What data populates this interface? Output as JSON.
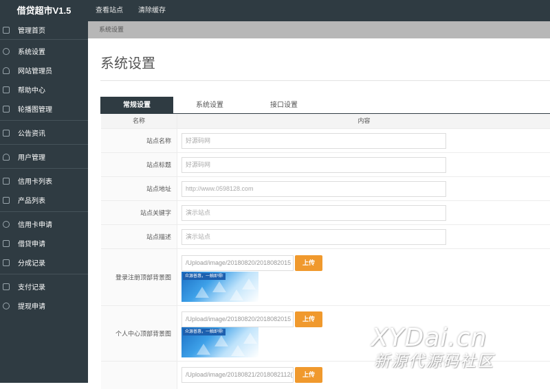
{
  "app": {
    "title": "借贷超市V1.5"
  },
  "topnav": [
    "查看站点",
    "清除缓存"
  ],
  "sidebar": {
    "items": [
      {
        "label": "管理首页",
        "icon": "home-icon"
      },
      {
        "label": "系统设置",
        "icon": "gear-icon"
      },
      {
        "label": "网站管理员",
        "icon": "user-icon"
      },
      {
        "label": "帮助中心",
        "icon": "help-icon"
      },
      {
        "label": "轮播图管理",
        "icon": "image-icon"
      },
      {
        "label": "公告资讯",
        "icon": "news-icon"
      },
      {
        "label": "用户管理",
        "icon": "users-icon"
      },
      {
        "label": "信用卡列表",
        "icon": "grid-icon"
      },
      {
        "label": "产品列表",
        "icon": "square-icon"
      },
      {
        "label": "信用卡申请",
        "icon": "link-icon"
      },
      {
        "label": "借贷申请",
        "icon": "edit-icon"
      },
      {
        "label": "分成记录",
        "icon": "record-icon"
      },
      {
        "label": "支付记录",
        "icon": "pay-icon"
      },
      {
        "label": "提现申请",
        "icon": "withdraw-icon"
      }
    ]
  },
  "breadcrumb": "系统设置",
  "page": {
    "title": "系统设置"
  },
  "tabs": [
    {
      "label": "常规设置",
      "active": true
    },
    {
      "label": "系统设置",
      "active": false
    },
    {
      "label": "接口设置",
      "active": false
    }
  ],
  "table": {
    "headers": [
      "名称",
      "内容"
    ],
    "rows": [
      {
        "label": "站点名称",
        "value": "好源码网"
      },
      {
        "label": "站点标题",
        "value": "好源码网"
      },
      {
        "label": "站点地址",
        "value": "http://www.0598128.com"
      },
      {
        "label": "站点关键字",
        "value": "演示站点"
      },
      {
        "label": "站点描述",
        "value": "演示站点"
      }
    ],
    "uploads": [
      {
        "label": "登录注册顶部背景图",
        "path": "/Upload/image/20180820/2018082015",
        "button": "上传",
        "thumb_tag": "众源普惠，一触即得!"
      },
      {
        "label": "个人中心顶部背景图",
        "path": "/Upload/image/20180820/2018082015",
        "button": "上传",
        "thumb_tag": "众源普惠，一触即得!"
      },
      {
        "label": "",
        "path": "/Upload/image/20180821/2018082112(",
        "button": "上传"
      }
    ]
  },
  "watermark": {
    "line1": "XYDai.cn",
    "line2": "新源代源码社区"
  },
  "colors": {
    "sidebar": "#2f3b42",
    "accent": "#f0992d",
    "crumb": "#b7b7b7"
  }
}
